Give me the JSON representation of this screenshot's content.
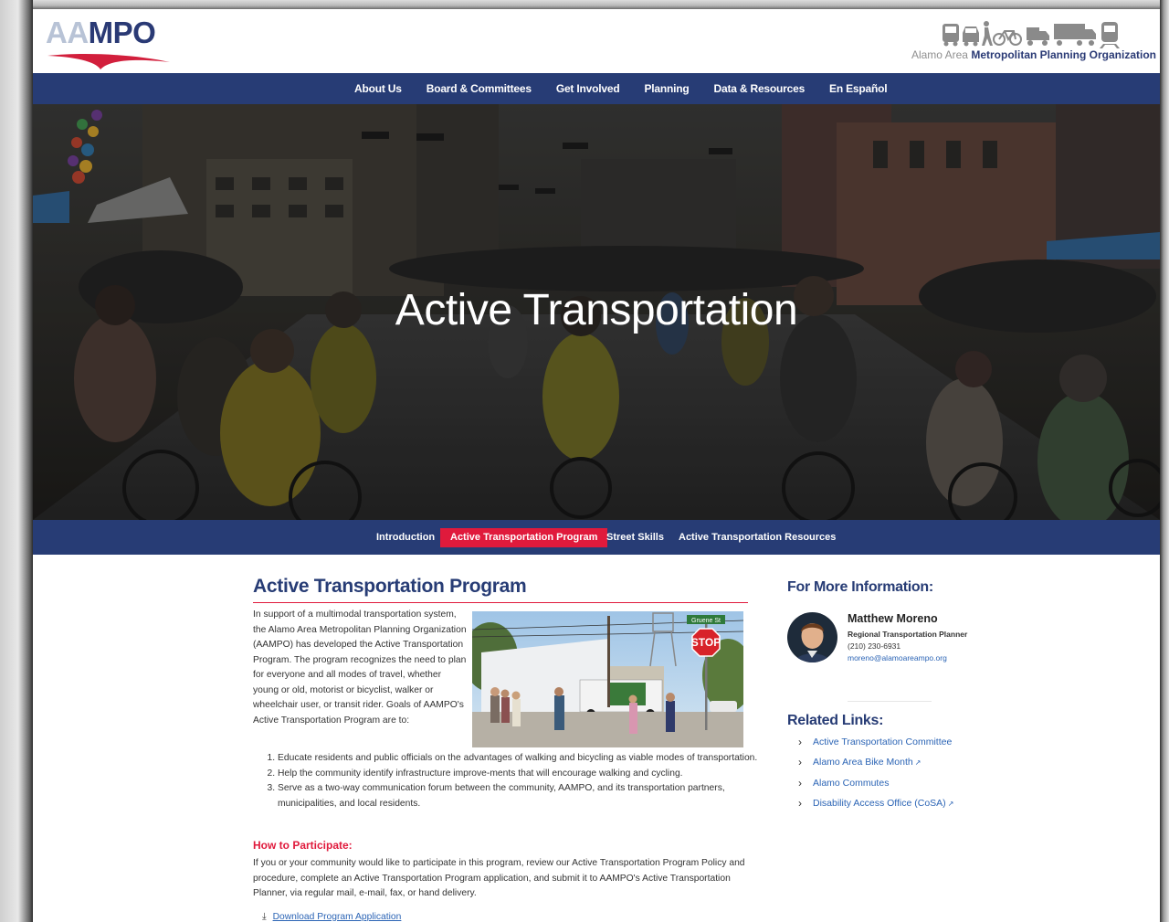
{
  "header": {
    "logo_aa": "AA",
    "logo_mpo": "MPO",
    "org_name_gray": "Alamo Area",
    "org_name_navy": "Metropolitan Planning Organization"
  },
  "main_nav": [
    "About Us",
    "Board & Committees",
    "Get Involved",
    "Planning",
    "Data & Resources",
    "En Español"
  ],
  "hero": {
    "title": "Active Transportation"
  },
  "sub_nav": {
    "items": [
      "Introduction",
      "Active Transportation Program",
      "Street Skills",
      "Active Transportation Resources"
    ],
    "active": "Active Transportation Program"
  },
  "content": {
    "heading": "Active Transportation Program",
    "intro": "In support of a multimodal transportation system, the Alamo Area Metropolitan Planning Organization (AAMPO) has developed the Active Transportation Program. The program recognizes the need to plan for everyone and all modes of travel, whether young or old, motorist or bicyclist, walker or wheelchair user, or transit rider. Goals of AAMPO's Active Transportation Program are to:",
    "photo_sign_street": "Gruene St",
    "photo_sign_stop": "STOP",
    "goals": [
      "Educate residents and public officials on the advantages of walking and bicycling as viable modes of transportation.",
      "Help the community identify infrastructure improve-ments that will encourage walking and cycling.",
      "Serve as a two-way communication forum between the community, AAMPO, and its transportation partners, municipalities, and local residents."
    ],
    "how_heading": "How to Participate:",
    "how_text": "If you or your community would like to participate in this program, review our Active Transportation Program Policy and procedure, complete an Active Transportation Program application, and submit it to AAMPO's Active Transportation Planner, via regular mail, e-mail, fax, or hand delivery.",
    "download_label": "Download Program Application"
  },
  "sidebar": {
    "info_heading": "For More Information:",
    "contact": {
      "name": "Matthew Moreno",
      "role": "Regional Transportation Planner",
      "phone": "(210) 230-6931",
      "email": "moreno@alamoareampo.org"
    },
    "related_heading": "Related Links:",
    "links": [
      {
        "label": "Active Transportation Committee",
        "external": false
      },
      {
        "label": "Alamo Area Bike Month",
        "external": true
      },
      {
        "label": "Alamo Commutes",
        "external": false
      },
      {
        "label": "Disability Access Office (CoSA)",
        "external": true
      }
    ]
  },
  "colors": {
    "navy": "#273c75",
    "accent_red": "#e01a3c",
    "link_blue": "#2b64b5"
  },
  "icons": [
    "bus-icon",
    "car-icon",
    "pedestrian-icon",
    "bicycle-icon",
    "truck-icon",
    "semi-truck-icon",
    "train-icon",
    "external-link-icon",
    "chevron-right-icon",
    "download-arrow-icon"
  ]
}
